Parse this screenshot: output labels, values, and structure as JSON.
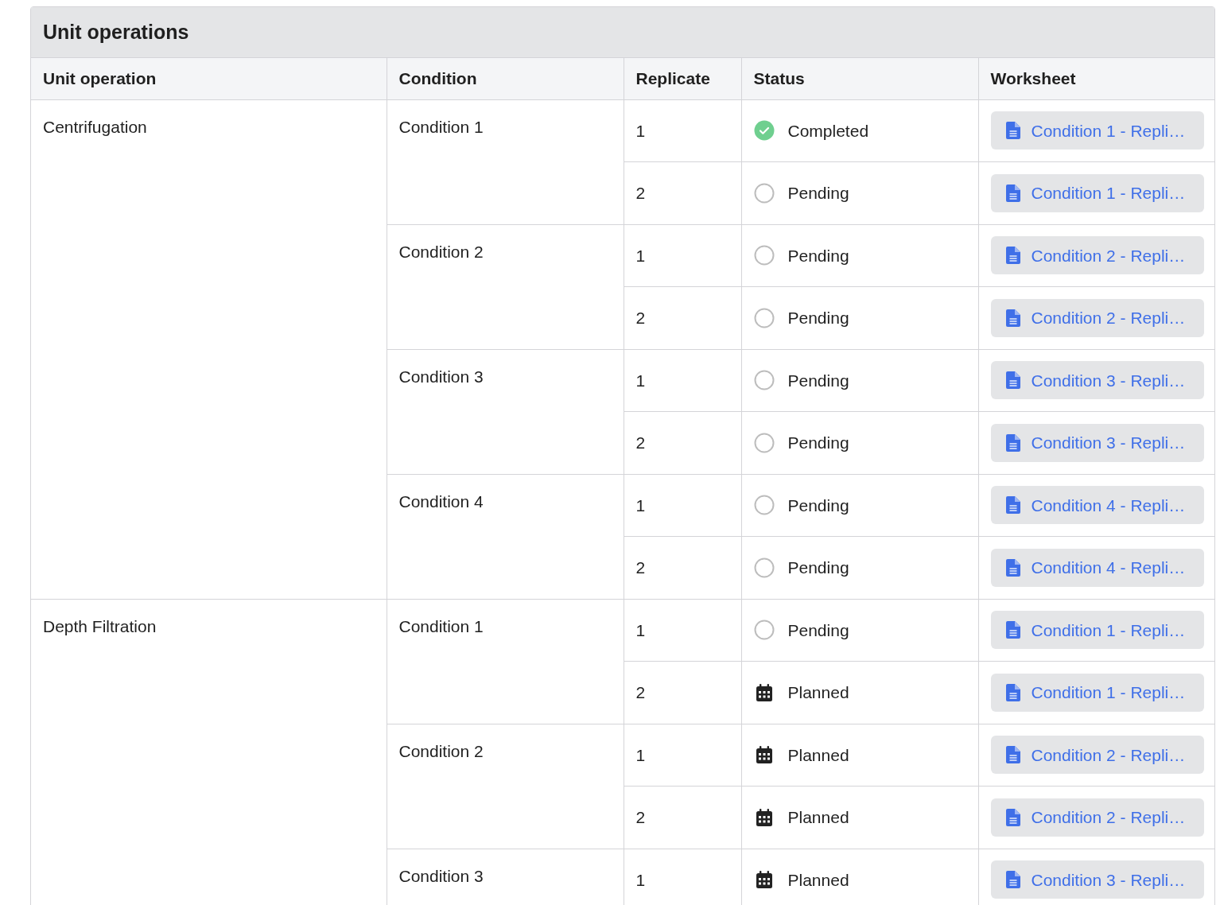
{
  "panel": {
    "title": "Unit operations"
  },
  "table": {
    "columns": [
      "Unit operation",
      "Condition",
      "Replicate",
      "Status",
      "Worksheet"
    ],
    "groups": [
      {
        "unit_operation": "Centrifugation",
        "conditions": [
          {
            "name": "Condition 1",
            "replicates": [
              {
                "replicate": "1",
                "status": {
                  "kind": "completed",
                  "label": "Completed"
                },
                "worksheet": "Condition 1 - Repli…"
              },
              {
                "replicate": "2",
                "status": {
                  "kind": "pending",
                  "label": "Pending"
                },
                "worksheet": "Condition 1 - Repli…"
              }
            ]
          },
          {
            "name": "Condition 2",
            "replicates": [
              {
                "replicate": "1",
                "status": {
                  "kind": "pending",
                  "label": "Pending"
                },
                "worksheet": "Condition 2 - Repli…"
              },
              {
                "replicate": "2",
                "status": {
                  "kind": "pending",
                  "label": "Pending"
                },
                "worksheet": "Condition 2 - Repli…"
              }
            ]
          },
          {
            "name": "Condition 3",
            "replicates": [
              {
                "replicate": "1",
                "status": {
                  "kind": "pending",
                  "label": "Pending"
                },
                "worksheet": "Condition 3 - Repli…"
              },
              {
                "replicate": "2",
                "status": {
                  "kind": "pending",
                  "label": "Pending"
                },
                "worksheet": "Condition 3 - Repli…"
              }
            ]
          },
          {
            "name": "Condition 4",
            "replicates": [
              {
                "replicate": "1",
                "status": {
                  "kind": "pending",
                  "label": "Pending"
                },
                "worksheet": "Condition 4 - Repli…"
              },
              {
                "replicate": "2",
                "status": {
                  "kind": "pending",
                  "label": "Pending"
                },
                "worksheet": "Condition 4 - Repli…"
              }
            ]
          }
        ]
      },
      {
        "unit_operation": "Depth Filtration",
        "conditions": [
          {
            "name": "Condition 1",
            "replicates": [
              {
                "replicate": "1",
                "status": {
                  "kind": "pending",
                  "label": "Pending"
                },
                "worksheet": "Condition 1 - Repli…"
              },
              {
                "replicate": "2",
                "status": {
                  "kind": "planned",
                  "label": "Planned"
                },
                "worksheet": "Condition 1 - Repli…"
              }
            ]
          },
          {
            "name": "Condition 2",
            "replicates": [
              {
                "replicate": "1",
                "status": {
                  "kind": "planned",
                  "label": "Planned"
                },
                "worksheet": "Condition 2 - Repli…"
              },
              {
                "replicate": "2",
                "status": {
                  "kind": "planned",
                  "label": "Planned"
                },
                "worksheet": "Condition 2 - Repli…"
              }
            ]
          },
          {
            "name": "Condition 3",
            "replicates": [
              {
                "replicate": "1",
                "status": {
                  "kind": "planned",
                  "label": "Planned"
                },
                "worksheet": "Condition 3 - Repli…"
              }
            ]
          }
        ]
      }
    ]
  }
}
